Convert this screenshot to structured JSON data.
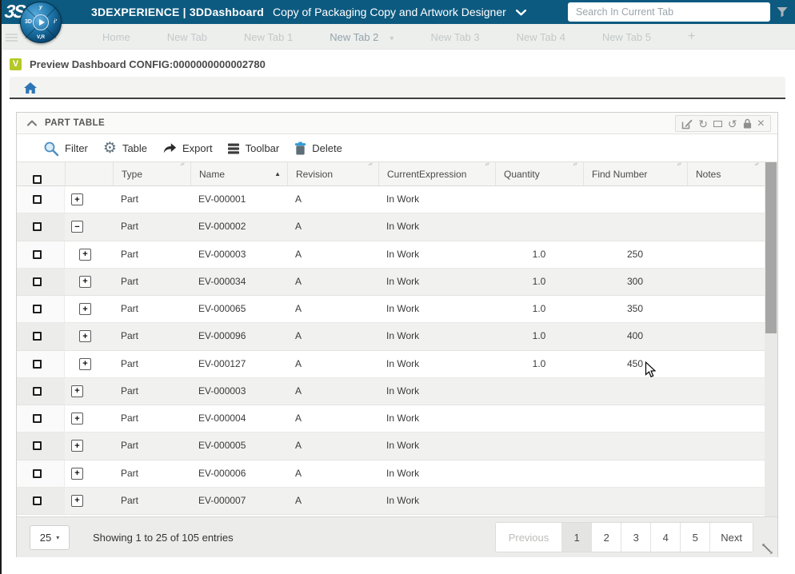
{
  "colors": {
    "topbar_bg": "#0d5a80",
    "accent_blue": "#2e75b6",
    "badge_green": "#b5c827",
    "delete_blue": "#2f9cd9",
    "scroll_thumb": "#a6a6a6"
  },
  "icons": {
    "refresh": "↻",
    "undo": "↺",
    "close": "×",
    "caret_down": "▾",
    "sort_asc": "▲",
    "sort_up_small": "▴",
    "sort_down_small": "▾",
    "gear": "⚙",
    "page_size_caret": "▾"
  },
  "topbar": {
    "logo": "3S",
    "brand": "3DEXPERIENCE | 3DDashboard",
    "dashboard_title": "Copy of Packaging Copy and Artwork Designer",
    "search_placeholder": "Search In Current Tab"
  },
  "compass": {
    "west": "3D",
    "south": "V,R",
    "north": "y",
    "east": "i’"
  },
  "tabs": {
    "items": [
      {
        "label": "Home"
      },
      {
        "label": "New Tab"
      },
      {
        "label": "New Tab 1"
      },
      {
        "label": "New Tab 2",
        "state": "active",
        "caret": true
      },
      {
        "label": "New Tab 3"
      },
      {
        "label": "New Tab 4"
      },
      {
        "label": "New Tab 5"
      },
      {
        "label": "+",
        "state": "add"
      }
    ]
  },
  "preview": {
    "badge": "V",
    "label": "Preview Dashboard CONFIG:0000000000002780"
  },
  "widget": {
    "title": "PART TABLE",
    "toolbar": {
      "filter": "Filter",
      "table": "Table",
      "export": "Export",
      "toolbar": "Toolbar",
      "delete": "Delete"
    },
    "header_icons": [
      "edit",
      "refresh",
      "maximize",
      "undo",
      "lock",
      "close"
    ]
  },
  "table": {
    "columns": [
      {
        "label": "Type",
        "sort": "both"
      },
      {
        "label": "Name",
        "sort": "asc"
      },
      {
        "label": "Revision",
        "sort": "both"
      },
      {
        "label": "CurrentExpression",
        "sort": "both"
      },
      {
        "label": "Quantity",
        "sort": "both"
      },
      {
        "label": "Find Number",
        "sort": "both"
      },
      {
        "label": "Notes",
        "sort": "both"
      }
    ],
    "rows": [
      {
        "level": 0,
        "expander": "+",
        "type": "Part",
        "name": "EV-000001",
        "revision": "A",
        "current_expression": "In Work",
        "quantity": "",
        "find_number": "",
        "notes": ""
      },
      {
        "level": 0,
        "expander": "−",
        "type": "Part",
        "name": "EV-000002",
        "revision": "A",
        "current_expression": "In Work",
        "quantity": "",
        "find_number": "",
        "notes": ""
      },
      {
        "level": 1,
        "expander": "+",
        "type": "Part",
        "name": "EV-000003",
        "revision": "A",
        "current_expression": "In Work",
        "quantity": "1.0",
        "find_number": "250",
        "notes": ""
      },
      {
        "level": 1,
        "expander": "+",
        "type": "Part",
        "name": "EV-000034",
        "revision": "A",
        "current_expression": "In Work",
        "quantity": "1.0",
        "find_number": "300",
        "notes": ""
      },
      {
        "level": 1,
        "expander": "+",
        "type": "Part",
        "name": "EV-000065",
        "revision": "A",
        "current_expression": "In Work",
        "quantity": "1.0",
        "find_number": "350",
        "notes": ""
      },
      {
        "level": 1,
        "expander": "+",
        "type": "Part",
        "name": "EV-000096",
        "revision": "A",
        "current_expression": "In Work",
        "quantity": "1.0",
        "find_number": "400",
        "notes": ""
      },
      {
        "level": 1,
        "expander": "+",
        "type": "Part",
        "name": "EV-000127",
        "revision": "A",
        "current_expression": "In Work",
        "quantity": "1.0",
        "find_number": "450",
        "notes": ""
      },
      {
        "level": 0,
        "expander": "+",
        "type": "Part",
        "name": "EV-000003",
        "revision": "A",
        "current_expression": "In Work",
        "quantity": "",
        "find_number": "",
        "notes": ""
      },
      {
        "level": 0,
        "expander": "+",
        "type": "Part",
        "name": "EV-000004",
        "revision": "A",
        "current_expression": "In Work",
        "quantity": "",
        "find_number": "",
        "notes": ""
      },
      {
        "level": 0,
        "expander": "+",
        "type": "Part",
        "name": "EV-000005",
        "revision": "A",
        "current_expression": "In Work",
        "quantity": "",
        "find_number": "",
        "notes": ""
      },
      {
        "level": 0,
        "expander": "+",
        "type": "Part",
        "name": "EV-000006",
        "revision": "A",
        "current_expression": "In Work",
        "quantity": "",
        "find_number": "",
        "notes": ""
      },
      {
        "level": 0,
        "expander": "+",
        "type": "Part",
        "name": "EV-000007",
        "revision": "A",
        "current_expression": "In Work",
        "quantity": "",
        "find_number": "",
        "notes": ""
      }
    ]
  },
  "footer": {
    "page_size": "25",
    "showing_text": "Showing 1 to 25 of 105 entries",
    "pagination": [
      {
        "label": "Previous",
        "state": "disabled"
      },
      {
        "label": "1",
        "state": "active"
      },
      {
        "label": "2"
      },
      {
        "label": "3"
      },
      {
        "label": "4"
      },
      {
        "label": "5"
      },
      {
        "label": "Next"
      }
    ]
  }
}
